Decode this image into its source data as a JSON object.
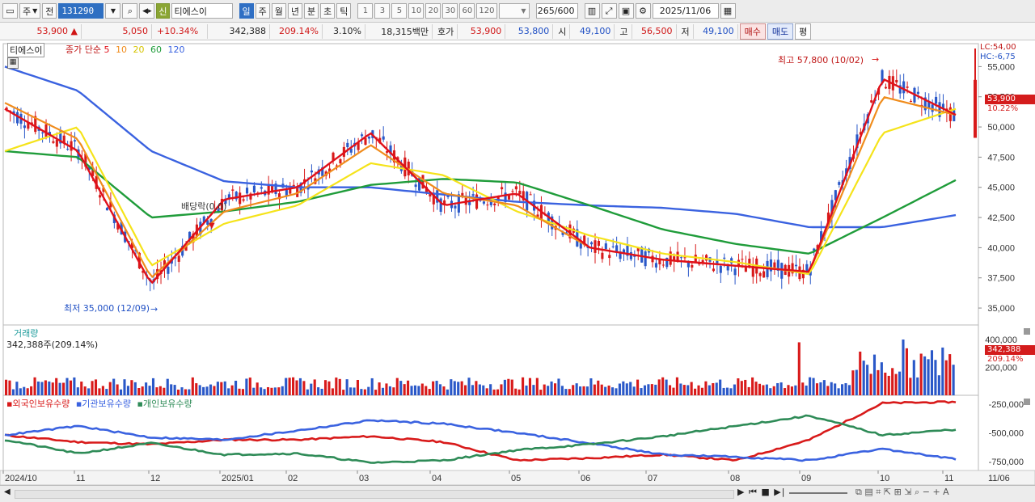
{
  "toolbar": {
    "period_tabs": [
      "주",
      "전"
    ],
    "stock_code": "131290",
    "credit_badge": "신",
    "stock_name": "티에스이",
    "interval_tabs": [
      "일",
      "주",
      "월",
      "년",
      "분",
      "초",
      "틱"
    ],
    "active_interval": "일",
    "minute_options": [
      "1",
      "3",
      "5",
      "10",
      "20",
      "30",
      "60",
      "120"
    ],
    "period_count": "265/600",
    "date": "2025/11/06"
  },
  "info": {
    "price": "53,900",
    "change_arrow": "▲",
    "change": "5,050",
    "change_rate": "+10.34%",
    "volume": "342,388",
    "volume_ratio": "209.14%",
    "turnover": "3.10%",
    "amount": "18,315백만",
    "bid_label": "호가",
    "ask_price": "53,900",
    "bid_price": "53,800",
    "open_label": "시",
    "open": "49,100",
    "high_label": "고",
    "high": "56,500",
    "low_label": "저",
    "low": "49,100",
    "buy_button": "매수",
    "sell_button": "매도",
    "eval_button": "평"
  },
  "price_panel": {
    "stock_tag": "티에스이",
    "ma_label": "종가 단순",
    "ma_periods": [
      "5",
      "10",
      "20",
      "60",
      "120"
    ],
    "lc_label": "LC:54,00",
    "hc_label": "HC:-6,75",
    "price_ticks": [
      "55,000",
      "52,500",
      "50,000",
      "47,500",
      "45,000",
      "42,500",
      "40,000",
      "37,500",
      "35,000"
    ],
    "current_price_tag": "53,900",
    "current_rate_tag": "10.22%",
    "high_annotation": "최고 57,800 (10/02)",
    "low_annotation": "최저 35,000 (12/09)",
    "dividend_annotation": "배당락(0,0)"
  },
  "volume_panel": {
    "title": "거래량",
    "value_label": "342,388주(209.14%)",
    "ticks": [
      "400,000",
      "200,000"
    ],
    "current_tag": "342,388",
    "current_rate_tag": "209.14%"
  },
  "holding_panel": {
    "legend": [
      "외국인보유수량",
      "기관보유수량",
      "개인보유수량"
    ],
    "ticks": [
      "-250,000",
      "-500,000",
      "-750,000"
    ]
  },
  "x_axis": {
    "labels": [
      "2024/10",
      "11",
      "12",
      "2025/01",
      "02",
      "03",
      "04",
      "05",
      "06",
      "07",
      "08",
      "09",
      "10",
      "11"
    ],
    "right_label": "11/06"
  },
  "colors": {
    "ma5": "#e0101a",
    "ma10": "#f08c1c",
    "ma20": "#f5e31a",
    "ma60": "#1f9c3a",
    "ma120": "#3a62e0",
    "up": "#d81a1a",
    "down": "#2a58c8",
    "foreign": "#d81a1a",
    "institution": "#3a62e0",
    "individual": "#2e8b57"
  },
  "chart_data": {
    "type": "line",
    "title": "티에스이 일봉",
    "x": [
      "2024/10",
      "11",
      "12",
      "2025/01",
      "02",
      "03",
      "04",
      "05",
      "06",
      "07",
      "08",
      "09",
      "10",
      "11"
    ],
    "ylim": [
      34000,
      56500
    ],
    "series": [
      {
        "name": "5",
        "values": [
          51500,
          48000,
          37000,
          44000,
          45000,
          49500,
          43500,
          44500,
          40000,
          39000,
          38500,
          38000,
          54000,
          51000
        ]
      },
      {
        "name": "10",
        "values": [
          52000,
          49000,
          37500,
          43000,
          44500,
          48500,
          44500,
          43500,
          40000,
          39000,
          38500,
          38000,
          52500,
          51000
        ]
      },
      {
        "name": "20",
        "values": [
          48000,
          50000,
          38500,
          42000,
          43500,
          47000,
          46000,
          43000,
          41000,
          39500,
          38800,
          37800,
          49500,
          51500
        ]
      },
      {
        "name": "60",
        "values": [
          48000,
          47500,
          42500,
          43000,
          43800,
          45200,
          45700,
          45400,
          43500,
          41500,
          40300,
          39500,
          42500,
          45600
        ]
      },
      {
        "name": "120",
        "values": [
          55000,
          53000,
          48000,
          45500,
          45000,
          45000,
          44400,
          43800,
          43500,
          43300,
          42800,
          41700,
          41700,
          42700
        ]
      }
    ],
    "high": {
      "value": 57800,
      "date": "10/02"
    },
    "low": {
      "value": 35000,
      "date": "12/09"
    },
    "volume_ylim": [
      0,
      400000
    ],
    "holding_ylim": [
      -800000,
      -200000
    ],
    "holding_series": [
      {
        "name": "외국인보유수량",
        "values": [
          -520000,
          -580000,
          -600000,
          -560000,
          -560000,
          -530000,
          -580000,
          -740000,
          -720000,
          -690000,
          -740000,
          -560000,
          -240000,
          -230000
        ]
      },
      {
        "name": "기관보유수량",
        "values": [
          -520000,
          -440000,
          -540000,
          -560000,
          -480000,
          -390000,
          -420000,
          -500000,
          -590000,
          -690000,
          -710000,
          -740000,
          -640000,
          -730000
        ]
      },
      {
        "name": "개인보유수량",
        "values": [
          -560000,
          -680000,
          -590000,
          -690000,
          -680000,
          -760000,
          -740000,
          -650000,
          -600000,
          -530000,
          -440000,
          -350000,
          -520000,
          -470000
        ]
      }
    ]
  }
}
